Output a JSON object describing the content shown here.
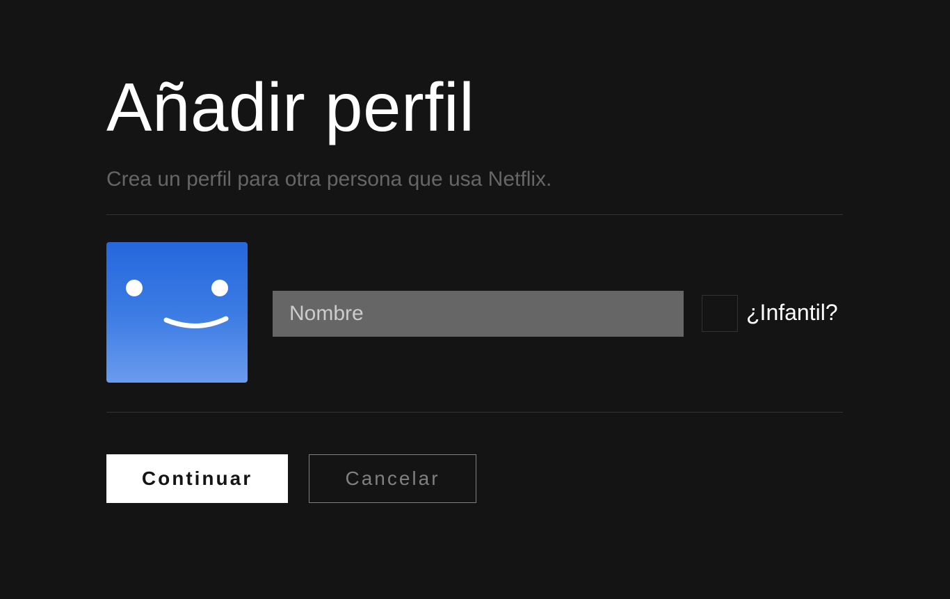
{
  "header": {
    "title": "Añadir perfil",
    "subtitle": "Crea un perfil para otra persona que usa Netflix."
  },
  "profile_form": {
    "avatar_icon": "smiley-face-icon",
    "name_placeholder": "Nombre",
    "name_value": "",
    "kids_label": "¿Infantil?",
    "kids_checked": false
  },
  "actions": {
    "continue_label": "Continuar",
    "cancel_label": "Cancelar"
  },
  "colors": {
    "background": "#141414",
    "avatar_blue": "#2667de",
    "input_bg": "#666666",
    "text_primary": "#ffffff",
    "text_muted": "#666666"
  }
}
